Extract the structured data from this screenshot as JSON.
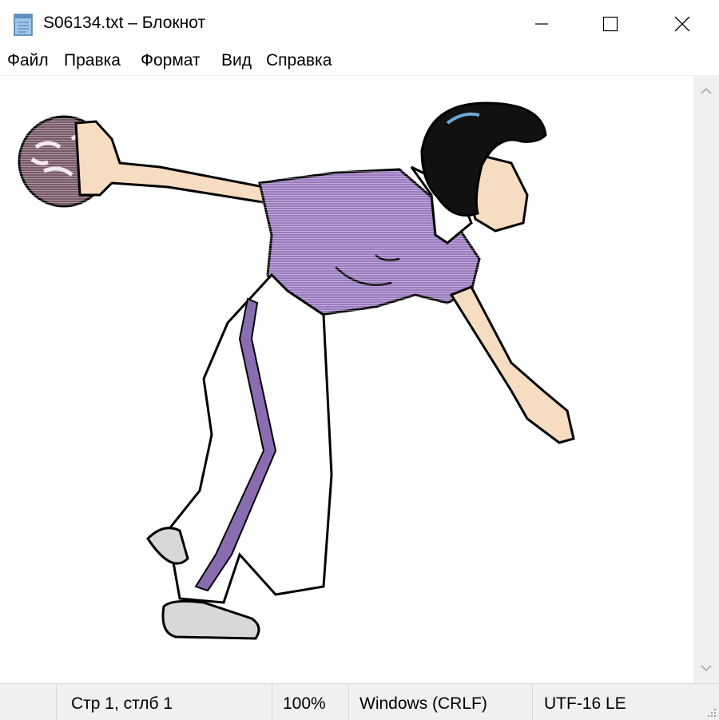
{
  "window": {
    "title": "S06134.txt – Блокнот",
    "icon": "notepad-icon",
    "controls": [
      "minimize-icon",
      "maximize-icon",
      "close-icon"
    ]
  },
  "menu": {
    "items": [
      "Файл",
      "Правка",
      "Формат",
      "Вид",
      "Справка"
    ]
  },
  "editor": {
    "content": "ASCII-art drawing of a woman bowling (purple shirt, white trousers with purple stripe, bowling ball)",
    "colors": {
      "shirt": "#9b7cc0",
      "hair": "#111111",
      "skin": "#f6dcc0",
      "ball": "#7a5a6a",
      "stripe": "#8a6cb0",
      "shoe": "#d8d8d8"
    }
  },
  "status": {
    "position": "Стр 1, стлб 1",
    "zoom": "100%",
    "line_ending": "Windows (CRLF)",
    "encoding": "UTF-16 LE"
  }
}
